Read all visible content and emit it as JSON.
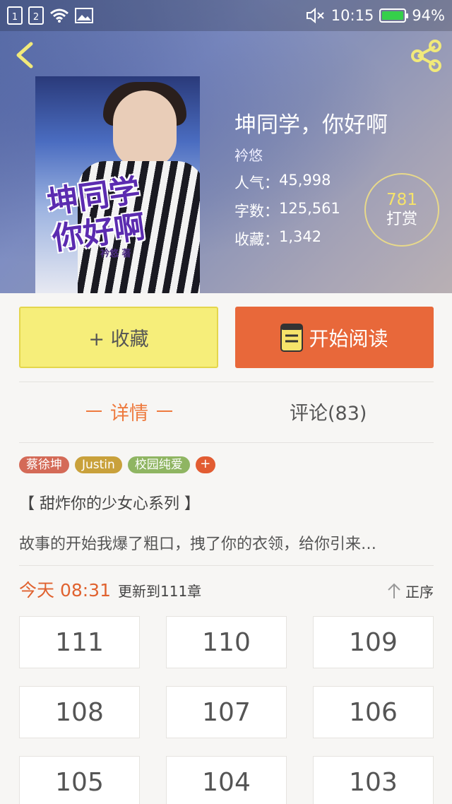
{
  "status_bar": {
    "sim1": "1",
    "sim2": "2",
    "time": "10:15",
    "battery": "94%"
  },
  "book": {
    "title": "坤同学，你好啊",
    "author": "衿悠",
    "popularity_label": "人气：",
    "popularity": "45,998",
    "words_label": "字数：",
    "words": "125,561",
    "favorites_label": "收藏：",
    "favorites": "1,342"
  },
  "cover": {
    "title_line1": "坤同学",
    "title_line2": "你好啊",
    "author_text": "衿悠 著"
  },
  "reward": {
    "count": "781",
    "label": "打赏"
  },
  "actions": {
    "favorite_label": "+ 收藏",
    "read_label": "开始阅读"
  },
  "tabs": {
    "detail": "详情",
    "comments": "评论(83)"
  },
  "tags": [
    {
      "label": "蔡徐坤",
      "color": "#d46a57"
    },
    {
      "label": "Justin",
      "color": "#c9a13b"
    },
    {
      "label": "校园纯爱",
      "color": "#8fb562"
    }
  ],
  "tag_more": "+",
  "series": "【 甜炸你的少女心系列 】",
  "synopsis": "故事的开始我爆了粗口，拽了你的衣领，给你引来…",
  "update": {
    "time": "今天 08:31",
    "text": "更新到111章"
  },
  "sort_label": "正序",
  "chapters": [
    "111",
    "110",
    "109",
    "108",
    "107",
    "106",
    "105",
    "104",
    "103"
  ],
  "colors": {
    "accent": "#e8683a",
    "favorite": "#f6ee7a",
    "tab_active": "#ee7a3e"
  }
}
